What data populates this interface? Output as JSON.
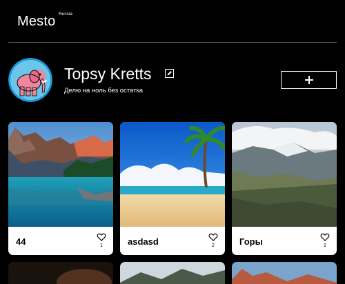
{
  "header": {
    "logo": "Mesto",
    "logo_sub": "Russia"
  },
  "profile": {
    "name": "Topsy Kretts",
    "about": "Делю на ноль без остатка",
    "edit_icon": "pencil-icon",
    "add_icon": "plus-icon"
  },
  "cards": [
    {
      "title": "44",
      "likes": "1",
      "image": "lake-mountains"
    },
    {
      "title": "asdasd",
      "likes": "2",
      "image": "beach-palm"
    },
    {
      "title": "Горы",
      "likes": "2",
      "image": "mountain-valley"
    }
  ],
  "colors": {
    "background": "#000000",
    "card": "#ffffff",
    "divider": "#545454"
  }
}
